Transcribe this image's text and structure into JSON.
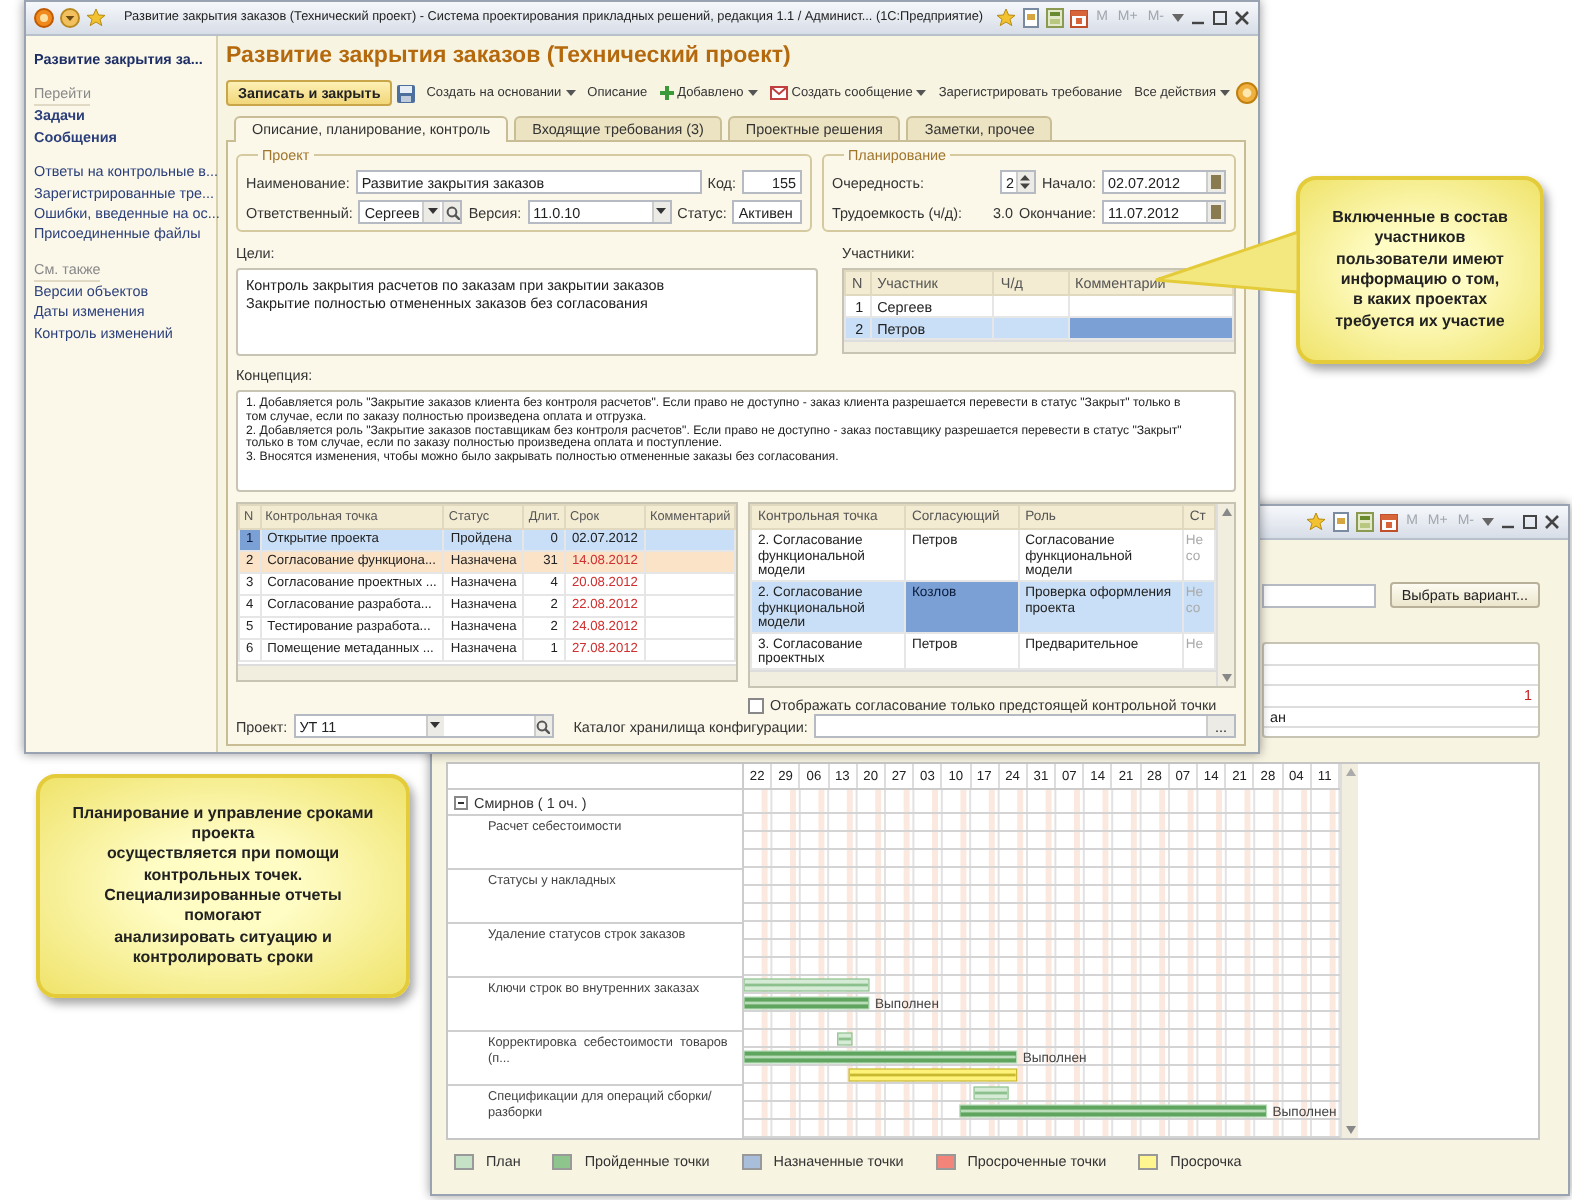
{
  "main_window": {
    "title": "Развитие закрытия заказов (Технический проект) - Система проектирования прикладных решений, редакция 1.1 / Админист... (1С:Предприятие)",
    "memory_keys": [
      "M",
      "M+",
      "M-"
    ],
    "sidebar": {
      "title": "Развитие закрытия за...",
      "sections": [
        {
          "heading": "Перейти",
          "items": [
            {
              "label": "Задачи",
              "bold": true
            },
            {
              "label": "Сообщения",
              "bold": true
            },
            {
              "label": "Ответы на контрольные в...",
              "bold": false
            },
            {
              "label": "Зарегистрированные тре...",
              "bold": false
            },
            {
              "label": "Ошибки, введенные на ос...",
              "bold": false
            },
            {
              "label": "Присоединенные файлы",
              "bold": false
            }
          ]
        },
        {
          "heading": "См. также",
          "items": [
            {
              "label": "Версии объектов",
              "bold": false
            },
            {
              "label": "Даты изменения",
              "bold": false
            },
            {
              "label": "Контроль изменений",
              "bold": false
            }
          ]
        }
      ]
    },
    "form_title": "Развитие закрытия заказов (Технический проект)",
    "toolbar": [
      {
        "kind": "primary",
        "label": "Записать и закрыть"
      },
      {
        "kind": "save"
      },
      {
        "kind": "menu",
        "label": "Создать на основании"
      },
      {
        "kind": "plain",
        "label": "Описание"
      },
      {
        "kind": "add",
        "label": "Добавлено"
      },
      {
        "kind": "message",
        "label": "Создать сообщение"
      },
      {
        "kind": "plain",
        "label": "Зарегистрировать требование"
      },
      {
        "kind": "end-menu",
        "label": "Все действия"
      },
      {
        "kind": "help"
      }
    ],
    "tabs": [
      {
        "label": "Описание, планирование, контроль",
        "selected": true
      },
      {
        "label": "Входящие требования (3)",
        "selected": false
      },
      {
        "label": "Проектные решения",
        "selected": false
      },
      {
        "label": "Заметки, прочее",
        "selected": false
      }
    ],
    "project_group": {
      "legend": "Проект",
      "name_label": "Наименование:",
      "name_value": "Развитие закрытия заказов",
      "code_label": "Код:",
      "code_value": "155",
      "owner_label": "Ответственный:",
      "owner_value": "Сергеев",
      "version_label": "Версия:",
      "version_value": "11.0.10",
      "status_label": "Статус:",
      "status_value": "Активен"
    },
    "planning_group": {
      "legend": "Планирование",
      "order_label": "Очередность:",
      "order_value": "2",
      "start_label": "Начало:",
      "start_value": "02.07.2012",
      "effort_label": "Трудоемкость (ч/д):",
      "effort_value": "3.0",
      "end_label": "Окончание:",
      "end_value": "11.07.2012"
    },
    "goals": {
      "label": "Цели:",
      "lines": [
        "Контроль закрытия расчетов по заказам при закрытии заказов",
        "Закрытие полностью отмененных заказов без согласования"
      ]
    },
    "participants": {
      "label": "Участники:",
      "columns": [
        "N",
        "Участник",
        "Ч/д",
        "Комментарий"
      ],
      "rows": [
        {
          "n": "1",
          "name": "Сергеев",
          "selected": false
        },
        {
          "n": "2",
          "name": "Петров",
          "selected": true
        }
      ]
    },
    "concept": {
      "label": "Концепция:",
      "lines": [
        "1. Добавляется роль \"Закрытие заказов клиента без контроля расчетов\". Если право не доступно - заказ клиента разрешается перевести в статус \"Закрыт\" только в",
        "том случае, если по заказу полностью произведена оплата и отгрузка.",
        "2. Добавляется роль \"Закрытие заказов поставщикам без контроля расчетов\". Если право не доступно - заказ поставщику  разрешается перевести в статус \"Закрыт\"",
        "только в том случае, если по заказу полностью произведена оплата и поступление.",
        "3. Вносятся изменения, чтобы можно было закрывать полностью отмененные заказы без согласования."
      ]
    },
    "checkpoints": {
      "columns": [
        "N",
        "Контрольная точка",
        "Статус",
        "Длит.",
        "Срок",
        "Комментарий"
      ],
      "rows": [
        {
          "n": "1",
          "point": "Открытие проекта",
          "status": "Пройдена",
          "duration": "0",
          "due": "02.07.2012",
          "overdue": false,
          "selected": true,
          "current": false
        },
        {
          "n": "2",
          "point": "Согласование функциона...",
          "status": "Назначена",
          "duration": "31",
          "due": "14.08.2012",
          "overdue": true,
          "selected": false,
          "current": true
        },
        {
          "n": "3",
          "point": "Согласование проектных ...",
          "status": "Назначена",
          "duration": "4",
          "due": "20.08.2012",
          "overdue": true,
          "selected": false,
          "current": false
        },
        {
          "n": "4",
          "point": "Согласование разработа...",
          "status": "Назначена",
          "duration": "2",
          "due": "22.08.2012",
          "overdue": true,
          "selected": false,
          "current": false
        },
        {
          "n": "5",
          "point": "Тестирование разработа...",
          "status": "Назначена",
          "duration": "2",
          "due": "24.08.2012",
          "overdue": true,
          "selected": false,
          "current": false
        },
        {
          "n": "6",
          "point": "Помещение метаданных ...",
          "status": "Назначена",
          "duration": "1",
          "due": "27.08.2012",
          "overdue": true,
          "selected": false,
          "current": false
        }
      ]
    },
    "approvals": {
      "columns": [
        "Контрольная точка",
        "Согласующий",
        "Роль",
        "Ст"
      ],
      "rows": [
        {
          "point": "2. Согласование функциональной модели",
          "approver": "Петров",
          "role": "Согласование функциональной модели",
          "status": "Не со",
          "selected": false
        },
        {
          "point": "2. Согласование функциональной модели",
          "approver": "Козлов",
          "role": "Проверка оформления проекта",
          "status": "Не со",
          "selected": true
        },
        {
          "point": "3. Согласование проектных",
          "approver": "Петров",
          "role": "Предварительное",
          "status": "Не",
          "selected": false
        }
      ]
    },
    "upcoming_only": {
      "label": "Отображать согласование только предстоящей контрольной точки",
      "checked": false
    },
    "project_field": {
      "label": "Проект:",
      "value": "УТ 11"
    },
    "catalog_field": {
      "label": "Каталог хранилища конфигурации:",
      "button": "..."
    }
  },
  "report_window": {
    "memory_keys": [
      "M",
      "M+",
      "M-"
    ],
    "variant_button": "Выбрать вариант...",
    "summary_value": "1",
    "summary_fragment": "ан",
    "gantt": {
      "ticks": [
        "22",
        "29",
        "06",
        "13",
        "20",
        "27",
        "03",
        "10",
        "17",
        "24",
        "31",
        "07",
        "14",
        "21",
        "28",
        "07",
        "14",
        "21",
        "28",
        "04",
        "11"
      ],
      "group": {
        "label": "Смирнов ( 1 оч. )",
        "expanded": true
      },
      "tasks": [
        {
          "name": "Расчет себестоимости"
        },
        {
          "name": "Статусы у накладных"
        },
        {
          "name": "Удаление статусов строк заказов"
        },
        {
          "name": "Ключи строк во внутренних заказах",
          "status": "Выполнен",
          "bars": [
            {
              "kind": "plan"
            },
            {
              "kind": "passed"
            }
          ]
        },
        {
          "name": "Корректировка  себестоимости  товаров (п...",
          "status": "Выполнен",
          "bars": [
            {
              "kind": "plan"
            },
            {
              "kind": "passed"
            },
            {
              "kind": "overdue"
            }
          ]
        },
        {
          "name": "Спецификации для операций сборки/разборки",
          "status": "Выполнен",
          "bars": [
            {
              "kind": "plan"
            },
            {
              "kind": "passed"
            }
          ]
        }
      ]
    },
    "legend": [
      {
        "label": "План",
        "color": "#c6e2c6"
      },
      {
        "label": "Пройденные точки",
        "color": "#8dc58d"
      },
      {
        "label": "Назначенные точки",
        "color": "#a9bedb"
      },
      {
        "label": "Просроченные точки",
        "color": "#f2847a"
      },
      {
        "label": "Просрочка",
        "color": "#fff68f"
      }
    ]
  },
  "callouts": [
    {
      "text": "Включенные в состав\nучастников\nпользователи имеют\nинформацию о том,\nв каких проектах\nтребуется их участие"
    },
    {
      "text": "Планирование и управление сроками\nпроекта\nосуществляется при помощи\nконтрольных точек.\nСпециализированные отчеты\nпомогают\nанализировать ситуацию и\nконтролировать сроки"
    }
  ]
}
